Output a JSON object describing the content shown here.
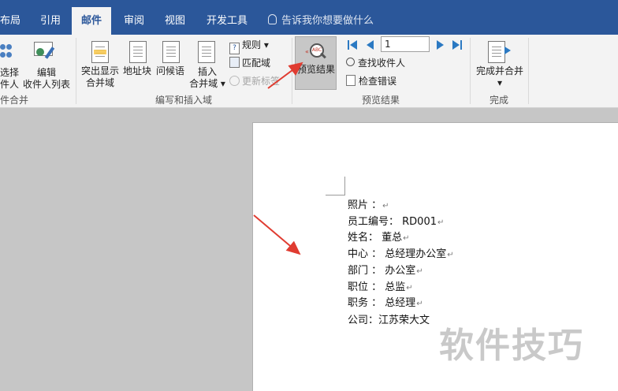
{
  "tabs": [
    {
      "label": "布局",
      "active": false
    },
    {
      "label": "引用",
      "active": false
    },
    {
      "label": "邮件",
      "active": true
    },
    {
      "label": "审阅",
      "active": false
    },
    {
      "label": "视图",
      "active": false
    },
    {
      "label": "开发工具",
      "active": false
    }
  ],
  "tell_me": "告诉我你想要做什么",
  "ribbon": {
    "start_group": {
      "select_label_1": "选择",
      "select_label_2": "件人",
      "edit_label_1": "编辑",
      "edit_label_2": "收件人列表",
      "group_label": "件合并"
    },
    "fields_group": {
      "highlight_1": "突出显示",
      "highlight_2": "合并域",
      "address": "地址块",
      "greeting": "问候语",
      "insert_1": "插入",
      "insert_2": "合并域",
      "rules": "规则",
      "match": "匹配域",
      "update": "更新标签",
      "group_label": "编写和插入域"
    },
    "preview_group": {
      "preview": "预览结果",
      "record": "1",
      "find": "查找收件人",
      "check": "检查错误",
      "group_label": "预览结果"
    },
    "finish_group": {
      "finish": "完成并合并",
      "group_label": "完成"
    }
  },
  "document": {
    "lines": [
      "照片 ：",
      "员工编号： RD001",
      "姓名： 董总",
      "中心 ： 总经理办公室",
      "部门 ： 办公室",
      "职位 ： 总监",
      "职务 ： 总经理",
      "公司：江苏荣大文"
    ],
    "paragraph_mark": "↵"
  },
  "watermark": "软件技巧",
  "colors": {
    "tab_bar": "#2b579a",
    "ribbon": "#f3f3f3",
    "arrow": "#e03c31"
  }
}
